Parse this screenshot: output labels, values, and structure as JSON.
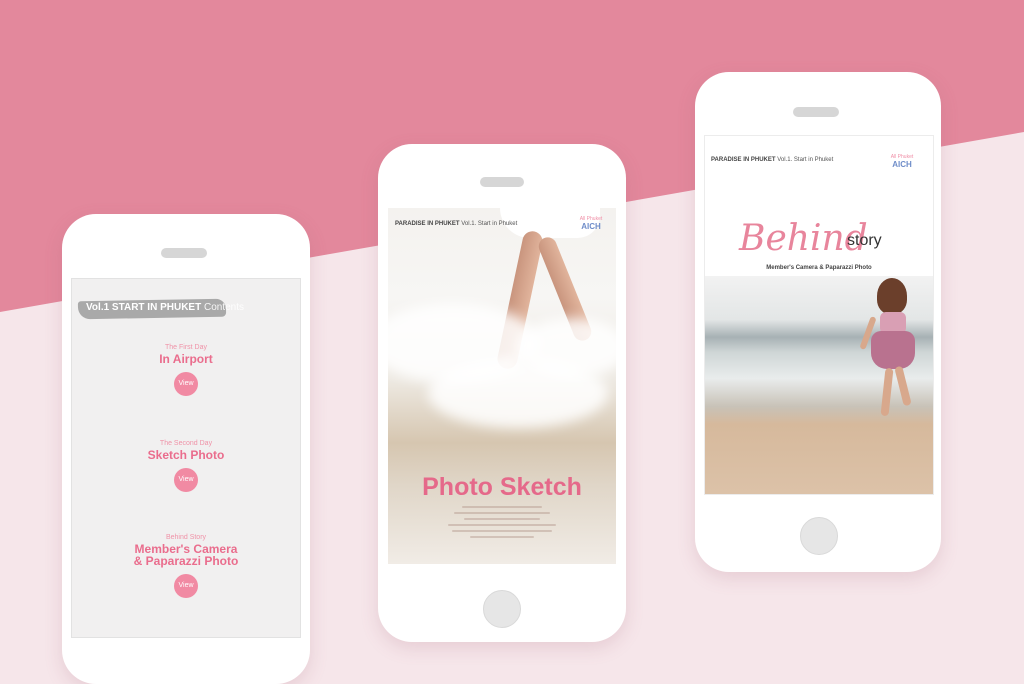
{
  "phone1": {
    "brand": "Vol.1 START IN PHUKET",
    "heading": "Contents",
    "items": [
      {
        "sub": "The First Day",
        "title": "In Airport",
        "button": "View"
      },
      {
        "sub": "The Second Day",
        "title": "Sketch Photo",
        "button": "View"
      },
      {
        "sub": "Behind Story",
        "title_line1": "Member's Camera",
        "title_line2": "& Paparazzi Photo",
        "button": "View"
      }
    ]
  },
  "phone2": {
    "header_bold": "PARADISE IN PHUKET",
    "header_rest": "Vol.1. Start in Phuket",
    "logo_line": "All Phuket",
    "logo_mark": "AICH",
    "title": "Photo Sketch"
  },
  "phone3": {
    "header_bold": "PARADISE IN PHUKET",
    "header_rest": "Vol.1. Start in Phuket",
    "logo_line": "All Phuket",
    "logo_mark": "AICH",
    "title_script": "Behind",
    "title_word": "story",
    "subtitle": "Member's Camera & Paparazzi Photo"
  },
  "colors": {
    "band": "#e3889c",
    "background": "#f6e6ea",
    "accent": "#ea6d8d",
    "button": "#f18aa3"
  }
}
